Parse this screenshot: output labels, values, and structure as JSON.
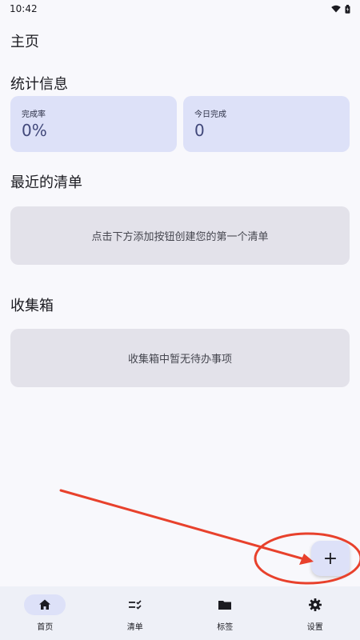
{
  "status_bar": {
    "time": "10:42"
  },
  "header": {
    "title": "主页"
  },
  "stats": {
    "title": "统计信息",
    "cards": [
      {
        "label": "完成率",
        "value": "0%"
      },
      {
        "label": "今日完成",
        "value": "0"
      }
    ]
  },
  "recent_lists": {
    "title": "最近的清单",
    "empty_text": "点击下方添加按钮创建您的第一个清单"
  },
  "inbox": {
    "title": "收集箱",
    "empty_text": "收集箱中暂无待办事项"
  },
  "fab": {
    "symbol": "+"
  },
  "bottom_nav": {
    "items": [
      {
        "label": "首页",
        "icon": "home-icon",
        "active": true
      },
      {
        "label": "清单",
        "icon": "checklist-icon",
        "active": false
      },
      {
        "label": "标签",
        "icon": "folder-icon",
        "active": false
      },
      {
        "label": "设置",
        "icon": "gear-icon",
        "active": false
      }
    ]
  },
  "colors": {
    "background": "#f8f8fc",
    "card_accent": "#dde1f8",
    "empty_card": "#e3e2ea",
    "nav_background": "#eef0f7",
    "annotation": "#e8412c"
  }
}
